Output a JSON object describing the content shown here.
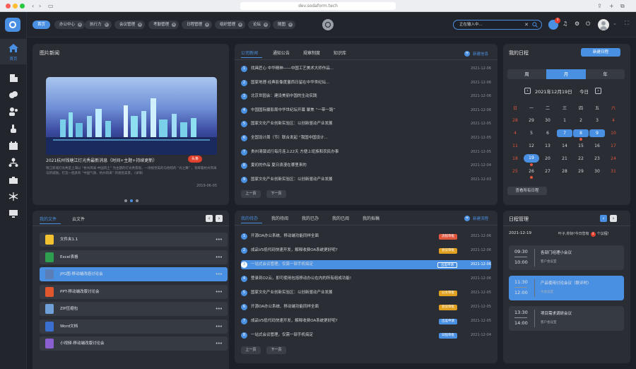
{
  "browser": {
    "url": "dev.sodaform.tech"
  },
  "tabs": [
    {
      "label": "首页",
      "active": true
    },
    {
      "label": "办公中心"
    },
    {
      "label": "执行力"
    },
    {
      "label": "会议管理"
    },
    {
      "label": "考勤管理"
    },
    {
      "label": "日程管理"
    },
    {
      "label": "组织管理"
    },
    {
      "label": "论坛"
    },
    {
      "label": "随图"
    }
  ],
  "search": {
    "value": "正在输入中..."
  },
  "sidebar": {
    "home_label": "首页"
  },
  "notifications": {
    "count": "3"
  },
  "news_panel": {
    "title": "图片新闻",
    "headline": "2021杭州钱塘江灯光秀最新消息（时间+主题+持续更新）",
    "tag": "头条",
    "summary": "钱江新城灯光秀是上海以 “杭州风采·中国风土” 为主题的灯光秀景观。一场视觉美的与他暗的 “光之舞” ，背辉着杭州风采与新城独，打造一批具有 “中国气质、杭州风采” 的视觉美景，（详情）",
    "date": "2019-06-05"
  },
  "announce_panel": {
    "tabs": [
      "公司新闻",
      "通知公告",
      "规章制度",
      "知识库"
    ],
    "new_button": "新建信息",
    "items": [
      {
        "n": "1",
        "text": "找具匠心 中华精神——中国工艺美术大师作品...",
        "date": "2021-12-06"
      },
      {
        "n": "2",
        "text": "国家地理·经典影像度量西日留在中华世纪坛...",
        "date": "2021-12-06"
      },
      {
        "n": "3",
        "text": "北京世园会：建设美丽中国的生动实践",
        "date": "2021-12-06"
      },
      {
        "n": "4",
        "text": "中国国际摄影周中华世纪坛开幕 聚焦 “一带一路”",
        "date": "2021-12-06"
      },
      {
        "n": "5",
        "text": "国家文化产业创新实验区：以创新驱动产业发展",
        "date": "2021-12-05"
      },
      {
        "n": "6",
        "text": "全国设计周（节）联合发起 “我国中国设计...",
        "date": "2021-12-05"
      },
      {
        "n": "7",
        "text": "贵州清镇试行每月连上22天 方便上班族和农民办事",
        "date": "2021-12-05"
      },
      {
        "n": "8",
        "text": "夏初的作品 夏日浪漫在哪里来的",
        "date": "2021-12-04"
      },
      {
        "n": "9",
        "text": "国家文化产业创新实验区：以创新驱动产业发展",
        "date": "2021-12-03"
      }
    ],
    "prev": "上一页",
    "next": "下一页"
  },
  "calendar_panel": {
    "title": "我的日程",
    "new_button": "新建日程",
    "views": [
      "周",
      "月",
      "年"
    ],
    "active_view": "月",
    "month_label": "2021年12月19日",
    "today_label": "今日",
    "weekdays": [
      "日",
      "一",
      "二",
      "三",
      "四",
      "五",
      "六"
    ],
    "weeks": [
      [
        "28",
        "29",
        "30",
        "1",
        "2",
        "3",
        "4"
      ],
      [
        "4",
        "5",
        "6",
        "7",
        "8",
        "9",
        "10"
      ],
      [
        "11",
        "12",
        "13",
        "14",
        "15",
        "16",
        "17"
      ],
      [
        "18",
        "19",
        "20",
        "21",
        "22",
        "23",
        "24"
      ],
      [
        "25",
        "26",
        "27",
        "28",
        "29",
        "30",
        "31"
      ]
    ],
    "row_labels": [
      "27",
      "4",
      "11",
      "24",
      "24"
    ],
    "view_all": "查看所有日程"
  },
  "files_panel": {
    "tabs": [
      "我的文件",
      "云文件"
    ],
    "files": [
      {
        "name": "文件夹1.1",
        "color": "#f2c230"
      },
      {
        "name": "Excel表格",
        "color": "#2e9e4f"
      },
      {
        "name": "JPG图-移动端改造讨论会",
        "color": "#5a7fb8",
        "active": true
      },
      {
        "name": "PPT-移动端改版讨论会",
        "color": "#e0562d"
      },
      {
        "name": "ZIP压缩包",
        "color": "#6fa0d8"
      },
      {
        "name": "Word文档",
        "color": "#3a6fd0"
      },
      {
        "name": "小视频-移动端改版讨论会",
        "color": "#8a5fd0"
      }
    ]
  },
  "todo_panel": {
    "tabs": [
      "我的待办",
      "我的待阅",
      "我的已办",
      "我的已阅",
      "我的拟稿"
    ],
    "new_button": "新建流程",
    "items": [
      {
        "n": "1",
        "text": "开源OA办公系统、移动端功能同样全面",
        "badge": "流程审批",
        "bcolor": "#e0563d",
        "date": "2021-12-06"
      },
      {
        "n": "2",
        "text": "成品VS低代码快速开发，解释收费OA系统更好呢?",
        "badge": "会议审批",
        "bcolor": "#e0a020",
        "date": "2021-12-06"
      },
      {
        "n": "3",
        "text": "一站式会议管理，仅需一部手机搞定",
        "badge": "出差申请",
        "bcolor": "#4a90e2",
        "date": "2021-12-06",
        "active": true
      },
      {
        "n": "4",
        "text": "登录到O2云，即可使用包括移动办公在内的所有组成功能!",
        "badge": "",
        "bcolor": "",
        "date": "2021-12-06"
      },
      {
        "n": "5",
        "text": "国家文化产业创新实验区：以创新驱动产业发展",
        "badge": "公文审批",
        "bcolor": "#e0a020",
        "date": "2021-12-05"
      },
      {
        "n": "6",
        "text": "开源OA办公系统、移动端功能同样全面",
        "badge": "会议审批",
        "bcolor": "#e0a020",
        "date": "2021-12-05"
      },
      {
        "n": "7",
        "text": "成品VS低代码快速开发，解释收费OA系统更好呢?",
        "badge": "出差申请",
        "bcolor": "#4a90e2",
        "date": "2021-12-05"
      },
      {
        "n": "8",
        "text": "一站式会议管理，仅需一部手机搞定",
        "badge": "日程审批",
        "bcolor": "#4a90e2",
        "date": "2021-12-04"
      }
    ],
    "prev": "上一页",
    "next": "下一页"
  },
  "schedule_panel": {
    "title": "日程管理",
    "date": "2021-12-19",
    "greeting": "叶子,你好!今日您有",
    "count": "3",
    "suffix": "个议程!",
    "events": [
      {
        "start": "09:30",
        "end": "10:00",
        "title": "各部门经理小会议",
        "loc": "客户会议室"
      },
      {
        "start": "11:30",
        "end": "12:00",
        "title": "产品使用讨论会议（联评时）",
        "loc": "大会议室",
        "active": true
      },
      {
        "start": "13:30",
        "end": "14:00",
        "title": "项目需求调研会议",
        "loc": "客户会议室"
      }
    ]
  },
  "colors": {
    "accent": "#4a90e2",
    "bg": "#1d2026",
    "panel": "#2a2d33"
  }
}
